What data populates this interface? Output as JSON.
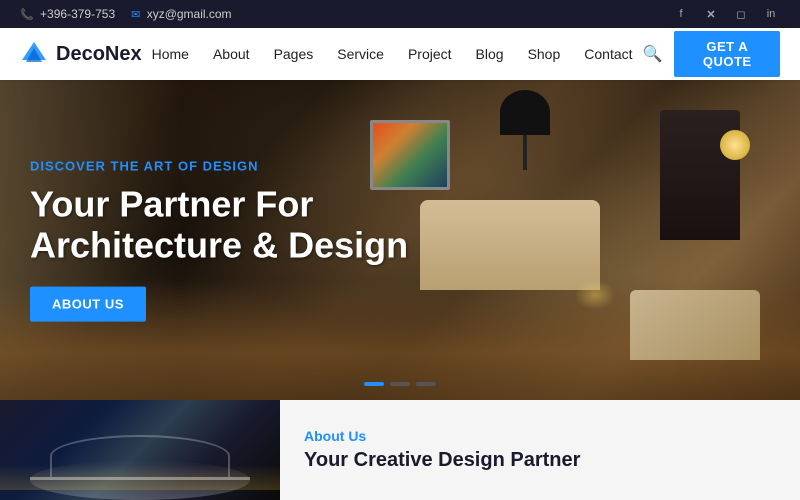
{
  "topbar": {
    "phone": "+396-379-753",
    "email": "xyz@gmail.com",
    "socials": [
      "facebook",
      "x-twitter",
      "instagram",
      "linkedin"
    ]
  },
  "navbar": {
    "logo_text_deco": "Deco",
    "logo_text_nex": "Nex",
    "links": [
      {
        "label": "Home",
        "id": "home"
      },
      {
        "label": "About",
        "id": "about"
      },
      {
        "label": "Pages",
        "id": "pages"
      },
      {
        "label": "Service",
        "id": "service"
      },
      {
        "label": "Project",
        "id": "project"
      },
      {
        "label": "Blog",
        "id": "blog"
      },
      {
        "label": "Shop",
        "id": "shop"
      },
      {
        "label": "Contact",
        "id": "contact"
      }
    ],
    "cta_label": "GET A QUOTE"
  },
  "hero": {
    "subtitle": "DISCOVER THE ART OF DESIGN",
    "title_line1": "Your Partner For",
    "title_line2": "Architecture & Design",
    "cta_label": "ABOUT US",
    "dots": [
      {
        "active": true
      },
      {
        "active": false
      },
      {
        "active": false
      }
    ]
  },
  "about_section": {
    "label": "About Us",
    "title_line1": "Your Creative Design Partner"
  }
}
